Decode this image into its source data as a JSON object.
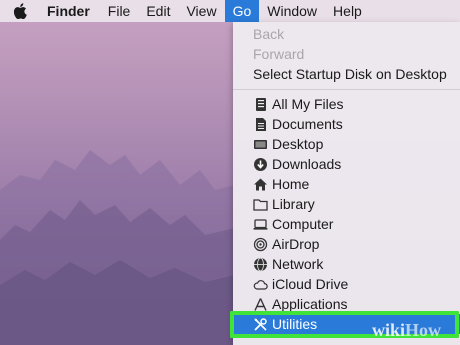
{
  "menubar": {
    "app_name": "Finder",
    "items": [
      "File",
      "Edit",
      "View",
      "Go",
      "Window",
      "Help"
    ],
    "active_item": "Go"
  },
  "go_menu": {
    "top_items": [
      {
        "label": "Back",
        "enabled": false
      },
      {
        "label": "Forward",
        "enabled": false
      },
      {
        "label": "Select Startup Disk on Desktop",
        "enabled": true
      }
    ],
    "places": [
      {
        "label": "All My Files",
        "icon": "all-my-files-icon"
      },
      {
        "label": "Documents",
        "icon": "documents-icon"
      },
      {
        "label": "Desktop",
        "icon": "desktop-icon"
      },
      {
        "label": "Downloads",
        "icon": "downloads-icon"
      },
      {
        "label": "Home",
        "icon": "home-icon"
      },
      {
        "label": "Library",
        "icon": "folder-icon"
      },
      {
        "label": "Computer",
        "icon": "computer-icon"
      },
      {
        "label": "AirDrop",
        "icon": "airdrop-icon"
      },
      {
        "label": "Network",
        "icon": "network-icon"
      },
      {
        "label": "iCloud Drive",
        "icon": "cloud-icon"
      },
      {
        "label": "Applications",
        "icon": "applications-icon"
      },
      {
        "label": "Utilities",
        "icon": "utilities-icon",
        "selected": true
      }
    ]
  },
  "watermark": {
    "part1": "wiki",
    "part2": "How"
  },
  "colors": {
    "menu_highlight": "#2a7bd9",
    "callout_box": "#3fe33a"
  }
}
